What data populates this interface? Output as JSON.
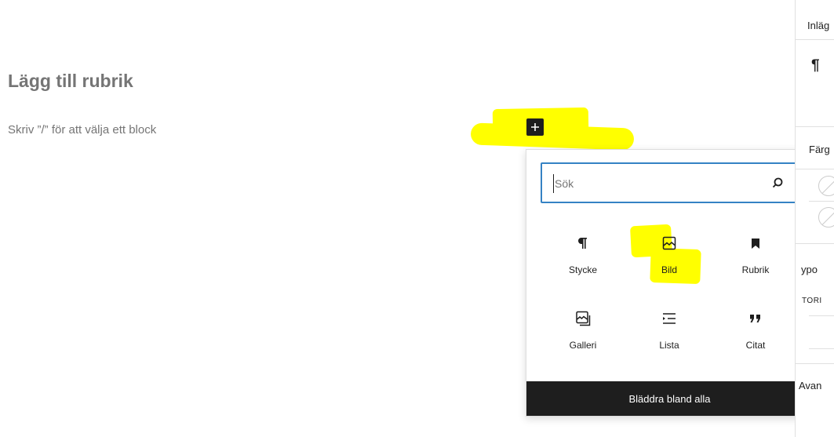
{
  "editor": {
    "title_placeholder": "Lägg till rubrik",
    "block_placeholder": "Skriv ”/” för att välja ett block"
  },
  "inserter": {
    "toggle_icon": "plus-icon",
    "search": {
      "value": "",
      "placeholder": "Sök",
      "icon": "search-icon"
    },
    "blocks": [
      {
        "label": "Stycke",
        "icon": "paragraph-icon"
      },
      {
        "label": "Bild",
        "icon": "image-icon"
      },
      {
        "label": "Rubrik",
        "icon": "heading-icon"
      },
      {
        "label": "Galleri",
        "icon": "gallery-icon"
      },
      {
        "label": "Lista",
        "icon": "list-icon"
      },
      {
        "label": "Citat",
        "icon": "quote-icon"
      }
    ],
    "browse_all": "Bläddra bland alla"
  },
  "sidebar": {
    "tab": "Inläg",
    "block_icon": "¶",
    "color_heading": "Färg",
    "typography_heading": "ypo",
    "typography_sub": "TORI",
    "advanced_heading": "Avan"
  },
  "colors": {
    "highlight": "#ffff00",
    "accent": "#3582c4",
    "dark": "#1e1e1e",
    "muted": "#757575"
  }
}
